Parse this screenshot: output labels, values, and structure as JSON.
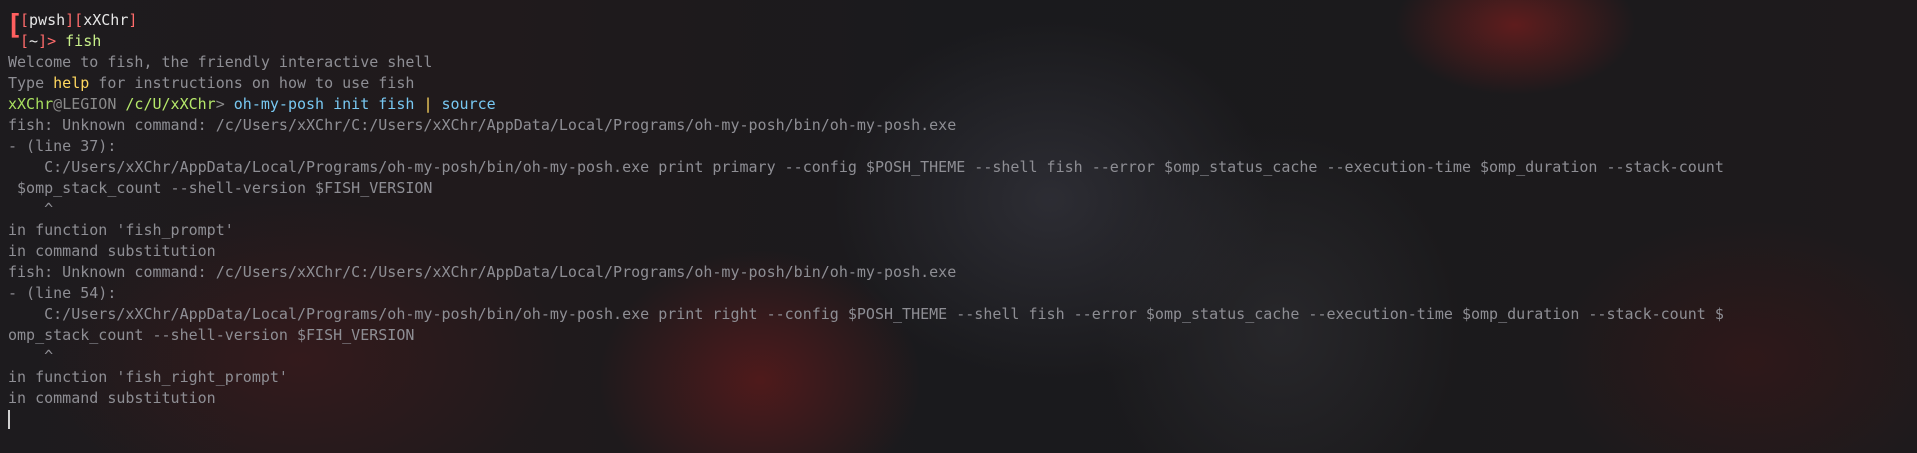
{
  "prompt_top": {
    "segments": [
      "pwsh",
      "xXChr"
    ],
    "dir": "~",
    "arrow": ">",
    "command": "fish"
  },
  "welcome": {
    "line1": "Welcome to fish, the friendly interactive shell",
    "line2_pre": "Type ",
    "line2_kw": "help",
    "line2_post": " for instructions on how to use fish"
  },
  "fish_prompt": {
    "user": "xXChr",
    "at": "@",
    "host": "LEGION",
    "cwd": "/c/U/xXChr",
    "arrow": ">",
    "cmd_part1": "oh-my-posh init fish",
    "pipe": "|",
    "cmd_part2": "source"
  },
  "output": [
    "fish: Unknown command: /c/Users/xXChr/C:/Users/xXChr/AppData/Local/Programs/oh-my-posh/bin/oh-my-posh.exe",
    "- (line 37):",
    "    C:/Users/xXChr/AppData/Local/Programs/oh-my-posh/bin/oh-my-posh.exe print primary --config $POSH_THEME --shell fish --error $omp_status_cache --execution-time $omp_duration --stack-count",
    " $omp_stack_count --shell-version $FISH_VERSION",
    "    ^",
    "in function 'fish_prompt'",
    "in command substitution",
    "fish: Unknown command: /c/Users/xXChr/C:/Users/xXChr/AppData/Local/Programs/oh-my-posh/bin/oh-my-posh.exe",
    "- (line 54):",
    "    C:/Users/xXChr/AppData/Local/Programs/oh-my-posh/bin/oh-my-posh.exe print right --config $POSH_THEME --shell fish --error $omp_status_cache --execution-time $omp_duration --stack-count $",
    "omp_stack_count --shell-version $FISH_VERSION",
    "    ^",
    "in function 'fish_right_prompt'",
    "in command substitution"
  ],
  "colors": {
    "error_text": "#8e8e94",
    "prompt_red": "#ff6b6b",
    "path_green": "#b5e86a",
    "command_blue": "#78c8f2",
    "help_yellow": "#ffd75f"
  }
}
